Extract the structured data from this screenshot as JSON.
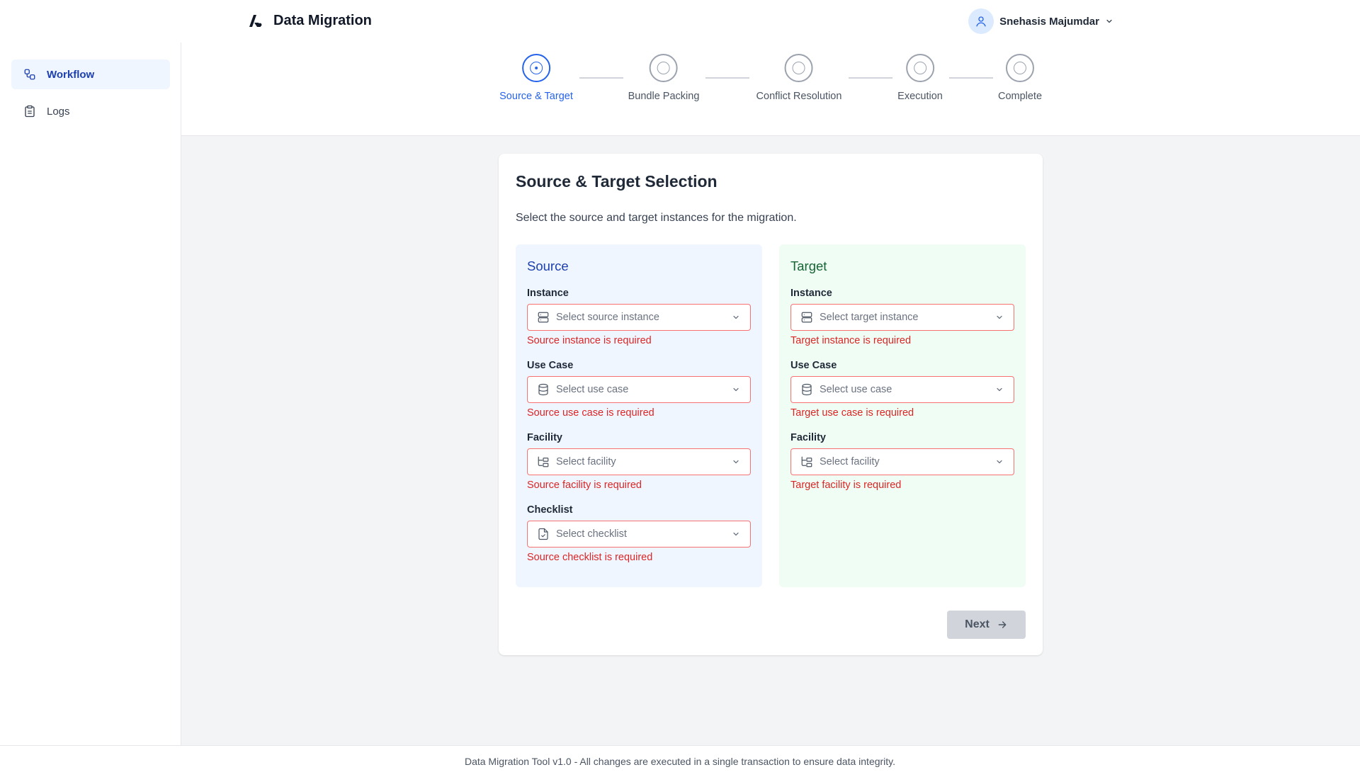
{
  "app": {
    "title": "Data Migration",
    "logo_icon": "brand-logo"
  },
  "user": {
    "name": "Snehasis Majumdar",
    "avatar_icon": "user-icon"
  },
  "sidebar": {
    "items": [
      {
        "label": "Workflow",
        "icon": "workflow-icon",
        "active": true
      },
      {
        "label": "Logs",
        "icon": "clipboard-icon",
        "active": false
      }
    ]
  },
  "stepper": {
    "steps": [
      {
        "label": "Source & Target",
        "active": true
      },
      {
        "label": "Bundle Packing",
        "active": false
      },
      {
        "label": "Conflict Resolution",
        "active": false
      },
      {
        "label": "Execution",
        "active": false
      },
      {
        "label": "Complete",
        "active": false
      }
    ]
  },
  "card": {
    "title": "Source & Target Selection",
    "description": "Select the source and target instances for the migration."
  },
  "source": {
    "title": "Source",
    "fields": [
      {
        "label": "Instance",
        "placeholder": "Select source instance",
        "error": "Source instance is required",
        "icon": "server-icon"
      },
      {
        "label": "Use Case",
        "placeholder": "Select use case",
        "error": "Source use case is required",
        "icon": "database-icon"
      },
      {
        "label": "Facility",
        "placeholder": "Select facility",
        "error": "Source facility is required",
        "icon": "folder-tree-icon"
      },
      {
        "label": "Checklist",
        "placeholder": "Select checklist",
        "error": "Source checklist is required",
        "icon": "file-check-icon"
      }
    ]
  },
  "target": {
    "title": "Target",
    "fields": [
      {
        "label": "Instance",
        "placeholder": "Select target instance",
        "error": "Target instance is required",
        "icon": "server-icon"
      },
      {
        "label": "Use Case",
        "placeholder": "Select use case",
        "error": "Target use case is required",
        "icon": "database-icon"
      },
      {
        "label": "Facility",
        "placeholder": "Select facility",
        "error": "Target facility is required",
        "icon": "folder-tree-icon"
      }
    ]
  },
  "actions": {
    "next_label": "Next"
  },
  "footer": {
    "text": "Data Migration Tool v1.0 - All changes are executed in a single transaction to ensure data integrity."
  },
  "colors": {
    "accent": "#2563eb",
    "error": "#dc2626",
    "source_bg": "#eff6ff",
    "target_bg": "#f0fdf4",
    "page_bg": "#f3f4f6"
  }
}
